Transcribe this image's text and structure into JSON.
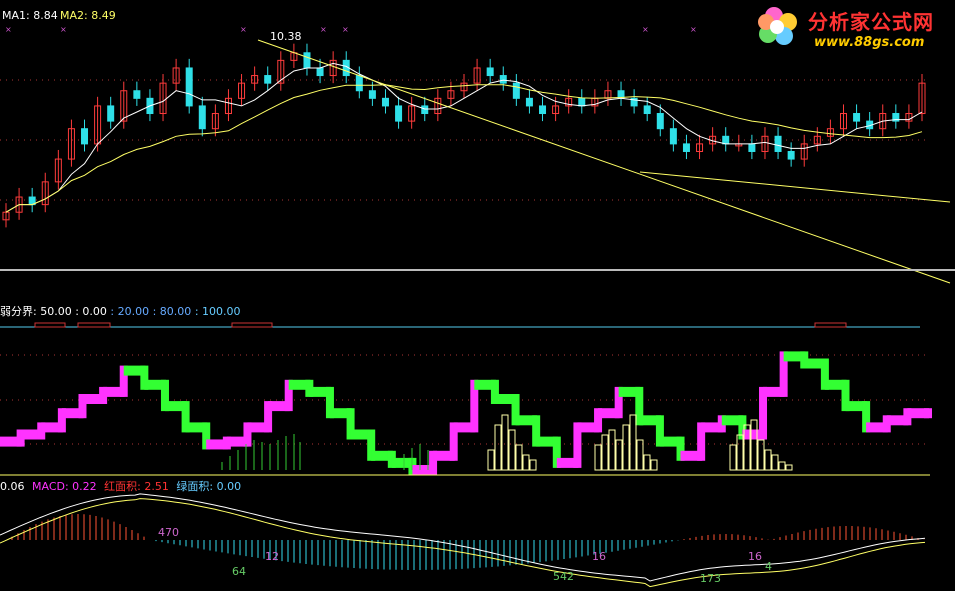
{
  "main_panel": {
    "ma1_label": "MA1: 8.84",
    "ma2_label": "MA2: 8.49",
    "peak_annotation": "10.38"
  },
  "strength_panel": {
    "label_prefix": "弱分界: 50.00",
    "label_values": [
      ": 0.00",
      ": 20.00",
      ": 80.00",
      ": 100.00"
    ]
  },
  "macd_panel": {
    "lead_value": "0.06",
    "macd_label": "MACD: 0.22",
    "red_area_label": "红面积: 2.51",
    "green_area_label": "绿面积: 0.00",
    "area_annotations": [
      "470",
      "64",
      "12",
      "542",
      "16",
      "173",
      "16",
      "4"
    ]
  },
  "logo": {
    "brand_text": "分析家公式网",
    "url_text": "www.88gs.com"
  },
  "colors": {
    "background": "#000000",
    "up_candle": "#ff3c3c",
    "down_candle": "#2fe0e8",
    "ma_line": "#ffffff",
    "ma2_line": "#ffff66",
    "strength_up": "#ff33ff",
    "strength_down": "#33ff33",
    "histogram_outline": "#ffffaa",
    "macd_red_bar": "#ff5533",
    "macd_cyan_bar": "#33ddee",
    "grid": "#aa3333",
    "separator": "#bbbbbb"
  },
  "chart_data": [
    {
      "type": "candlestick",
      "title": "",
      "series": [
        {
          "name": "MA1",
          "last_value": 8.84
        },
        {
          "name": "MA2",
          "last_value": 8.49
        }
      ],
      "annotations": [
        {
          "text": "10.38",
          "kind": "peak high"
        }
      ],
      "closes": [
        8.2,
        8.4,
        8.3,
        8.6,
        8.9,
        9.3,
        9.1,
        9.6,
        9.4,
        9.8,
        9.7,
        9.5,
        9.9,
        10.1,
        9.6,
        9.3,
        9.5,
        9.7,
        9.9,
        10.0,
        9.9,
        10.2,
        10.3,
        10.1,
        10.0,
        10.2,
        10.0,
        9.8,
        9.7,
        9.6,
        9.4,
        9.6,
        9.5,
        9.7,
        9.8,
        9.9,
        10.1,
        10.0,
        9.9,
        9.7,
        9.6,
        9.5,
        9.6,
        9.7,
        9.6,
        9.7,
        9.8,
        9.7,
        9.6,
        9.5,
        9.3,
        9.1,
        9.0,
        9.1,
        9.2,
        9.1,
        9.1,
        9.0,
        9.2,
        9.0,
        8.9,
        9.1,
        9.2,
        9.3,
        9.5,
        9.4,
        9.3,
        9.5,
        9.4,
        9.5,
        9.9
      ]
    },
    {
      "type": "step",
      "title": "",
      "reference_levels": [
        0,
        20,
        50,
        80,
        100
      ],
      "ylim": [
        0,
        100
      ],
      "values": [
        20,
        25,
        30,
        40,
        50,
        55,
        70,
        60,
        45,
        30,
        18,
        20,
        30,
        45,
        60,
        55,
        40,
        25,
        10,
        5,
        0,
        10,
        30,
        60,
        50,
        35,
        20,
        5,
        30,
        40,
        55,
        35,
        20,
        10,
        30,
        35,
        25,
        55,
        80,
        75,
        60,
        45,
        30,
        35,
        40
      ]
    },
    {
      "type": "bar",
      "title": "",
      "series": [
        {
          "name": "MACD",
          "last_value": 0.22
        },
        {
          "name": "红面积",
          "last_value": 2.51
        },
        {
          "name": "绿面积",
          "last_value": 0.0
        }
      ],
      "area_labels": [
        "470",
        "64",
        "12",
        "542",
        "16",
        "173",
        "16",
        "4"
      ]
    }
  ]
}
